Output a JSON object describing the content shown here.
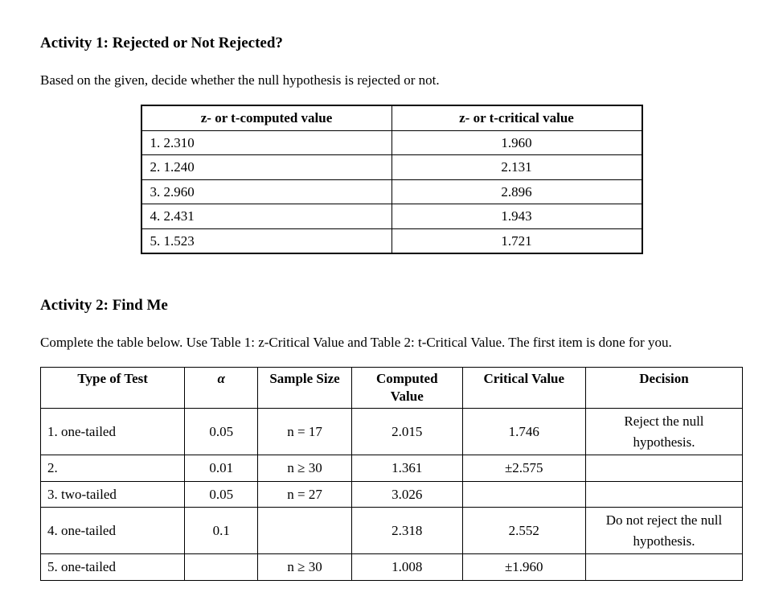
{
  "activity1": {
    "title": "Activity 1: Rejected or Not Rejected?",
    "instruction": "Based on the given, decide whether the null hypothesis is rejected or not.",
    "headers": {
      "computed": "z- or t-computed value",
      "critical": "z- or t-critical value"
    },
    "rows": [
      {
        "computed": "1.  2.310",
        "critical": "1.960"
      },
      {
        "computed": "2.  1.240",
        "critical": "2.131"
      },
      {
        "computed": "3.  2.960",
        "critical": "2.896"
      },
      {
        "computed": "4.  2.431",
        "critical": "1.943"
      },
      {
        "computed": "5.  1.523",
        "critical": "1.721"
      }
    ]
  },
  "activity2": {
    "title": "Activity 2: Find Me",
    "instruction": "Complete the table below. Use Table 1: z-Critical Value and Table 2: t-Critical Value. The first item is done for you.",
    "headers": {
      "type": "Type of Test",
      "alpha": "α",
      "sample": "Sample Size",
      "computed": "Computed Value",
      "critical": "Critical Value",
      "decision": "Decision"
    },
    "rows": [
      {
        "type": "1. one-tailed",
        "alpha": "0.05",
        "sample": "n = 17",
        "computed": "2.015",
        "critical": "1.746",
        "decision": "Reject the null hypothesis."
      },
      {
        "type": "2.",
        "alpha": "0.01",
        "sample": "n ≥ 30",
        "computed": "1.361",
        "critical": "±2.575",
        "decision": ""
      },
      {
        "type": "3. two-tailed",
        "alpha": "0.05",
        "sample": "n = 27",
        "computed": "3.026",
        "critical": "",
        "decision": ""
      },
      {
        "type": "4. one-tailed",
        "alpha": "0.1",
        "sample": "",
        "computed": "2.318",
        "critical": "2.552",
        "decision": "Do not reject the null hypothesis."
      },
      {
        "type": "5. one-tailed",
        "alpha": "",
        "sample": "n ≥ 30",
        "computed": "1.008",
        "critical": "±1.960",
        "decision": ""
      }
    ]
  }
}
